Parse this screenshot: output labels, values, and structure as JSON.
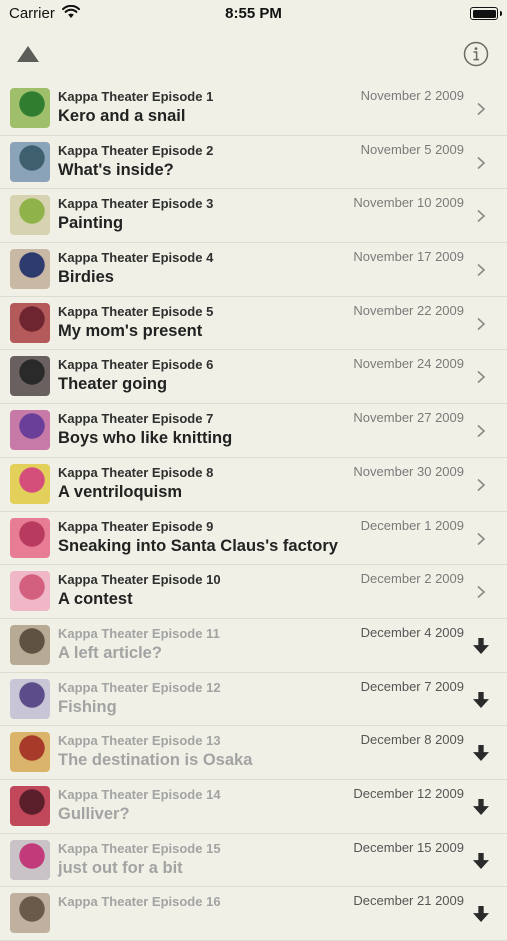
{
  "status_bar": {
    "carrier": "Carrier",
    "time": "8:55 PM"
  },
  "nav": {
    "up_icon": "triangle-up-icon",
    "info_icon": "info-circle-icon"
  },
  "episodes": [
    {
      "episode": "Kappa Theater Episode 1",
      "date": "November 2 2009",
      "title": "Kero and a snail",
      "state": "available",
      "thumb": [
        "#9fbf6a",
        "#2f7d2f"
      ]
    },
    {
      "episode": "Kappa Theater Episode 2",
      "date": "November 5 2009",
      "title": "What's inside?",
      "state": "available",
      "thumb": [
        "#8aa3b8",
        "#3e5f6e"
      ]
    },
    {
      "episode": "Kappa Theater Episode 3",
      "date": "November 10 2009",
      "title": "Painting",
      "state": "available",
      "thumb": [
        "#d7d3b0",
        "#8fb34a"
      ]
    },
    {
      "episode": "Kappa Theater Episode 4",
      "date": "November 17 2009",
      "title": "Birdies",
      "state": "available",
      "thumb": [
        "#c9b8a4",
        "#2e3b6e"
      ]
    },
    {
      "episode": "Kappa Theater Episode 5",
      "date": "November 22 2009",
      "title": "My mom's present",
      "state": "available",
      "thumb": [
        "#b55a5a",
        "#6e2530"
      ]
    },
    {
      "episode": "Kappa Theater Episode 6",
      "date": "November 24 2009",
      "title": "Theater going",
      "state": "available",
      "thumb": [
        "#6a6060",
        "#2a2a2a"
      ]
    },
    {
      "episode": "Kappa Theater Episode 7",
      "date": "November 27 2009",
      "title": "Boys who like knitting",
      "state": "available",
      "thumb": [
        "#c77aa8",
        "#6a3f9a"
      ]
    },
    {
      "episode": "Kappa Theater Episode 8",
      "date": "November 30 2009",
      "title": "A ventriloquism",
      "state": "available",
      "thumb": [
        "#e2d05a",
        "#d44f7a"
      ]
    },
    {
      "episode": "Kappa Theater Episode 9",
      "date": "December 1 2009",
      "title": "Sneaking into Santa Claus's factory",
      "state": "available",
      "thumb": [
        "#e87c95",
        "#b83a5e"
      ]
    },
    {
      "episode": "Kappa Theater Episode 10",
      "date": "December 2 2009",
      "title": "A contest",
      "state": "available",
      "thumb": [
        "#efb7c8",
        "#d4607f"
      ]
    },
    {
      "episode": "Kappa Theater Episode 11",
      "date": "December 4 2009",
      "title": "A left article?",
      "state": "download",
      "thumb": [
        "#b8ab96",
        "#5f5243"
      ]
    },
    {
      "episode": "Kappa Theater Episode 12",
      "date": "December 7 2009",
      "title": "Fishing",
      "state": "download",
      "thumb": [
        "#c8c6d6",
        "#5a4d8a"
      ]
    },
    {
      "episode": "Kappa Theater Episode 13",
      "date": "December 8 2009",
      "title": "The destination is Osaka",
      "state": "download",
      "thumb": [
        "#d9b46a",
        "#a83a2a"
      ]
    },
    {
      "episode": "Kappa Theater Episode 14",
      "date": "December 12 2009",
      "title": "Gulliver?",
      "state": "download",
      "thumb": [
        "#c0485a",
        "#5a1f2a"
      ]
    },
    {
      "episode": "Kappa Theater Episode 15",
      "date": "December 15 2009",
      "title": "just out for a bit",
      "state": "download",
      "thumb": [
        "#c9c2c6",
        "#c33a7a"
      ]
    },
    {
      "episode": "Kappa Theater Episode 16",
      "date": "December 21 2009",
      "title": "",
      "state": "download",
      "thumb": [
        "#bfb0a0",
        "#6a5a4a"
      ]
    }
  ],
  "icons": {
    "available": "chevron-right-icon",
    "download": "download-arrow-icon"
  }
}
